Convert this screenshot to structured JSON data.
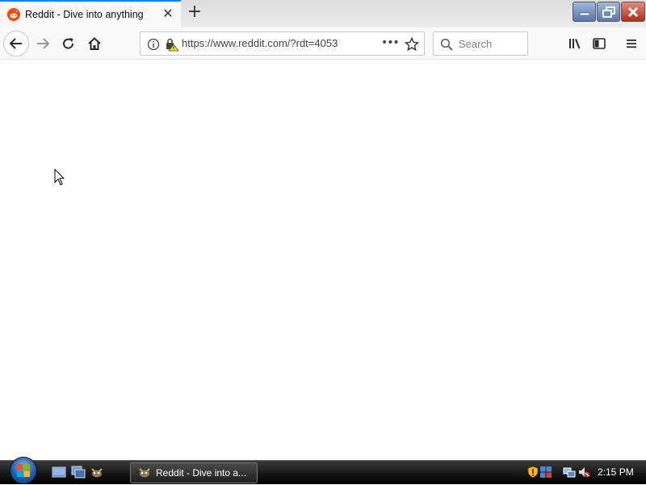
{
  "browser": {
    "tab": {
      "title": "Reddit - Dive into anything",
      "favicon": "reddit-icon"
    },
    "url": "https://www.reddit.com/?rdt=4053",
    "search_placeholder": "Search"
  },
  "taskbar": {
    "task_label": "Reddit - Dive into a...",
    "clock": "2:15 PM"
  },
  "colors": {
    "tab_accent": "#0a84ff",
    "reddit_orange": "#ff4500"
  }
}
